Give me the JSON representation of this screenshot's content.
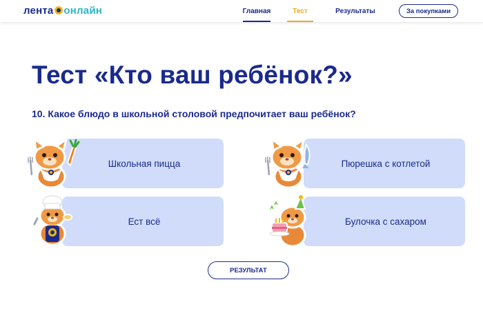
{
  "header": {
    "logo": {
      "part1": "лента",
      "part2": "онлайн"
    },
    "nav": [
      {
        "label": "Главная",
        "active": false
      },
      {
        "label": "Тест",
        "active": true
      },
      {
        "label": "Результаты",
        "active": false
      }
    ],
    "shop_button": "За покупками"
  },
  "main": {
    "title": "Тест «Кто ваш ребёнок?»",
    "question": "10. Какое блюдо в школьной столовой предпочитает ваш ребёнок?",
    "answers": [
      {
        "label": "Школьная пицца",
        "mascot": "cat-with-carrot-icon"
      },
      {
        "label": "Ест всё",
        "mascot": "cat-chef-icon"
      },
      {
        "label": "Пюрешка с котлетой",
        "mascot": "cat-with-fish-icon"
      },
      {
        "label": "Булочка с сахаром",
        "mascot": "cat-with-cake-icon"
      }
    ],
    "result_button": "РЕЗУЛЬТАТ"
  },
  "colors": {
    "brand_blue": "#1a2a8c",
    "accent_orange": "#f2a71b",
    "card_bg": "#d0dcfa",
    "logo_teal": "#2bb5c5"
  }
}
